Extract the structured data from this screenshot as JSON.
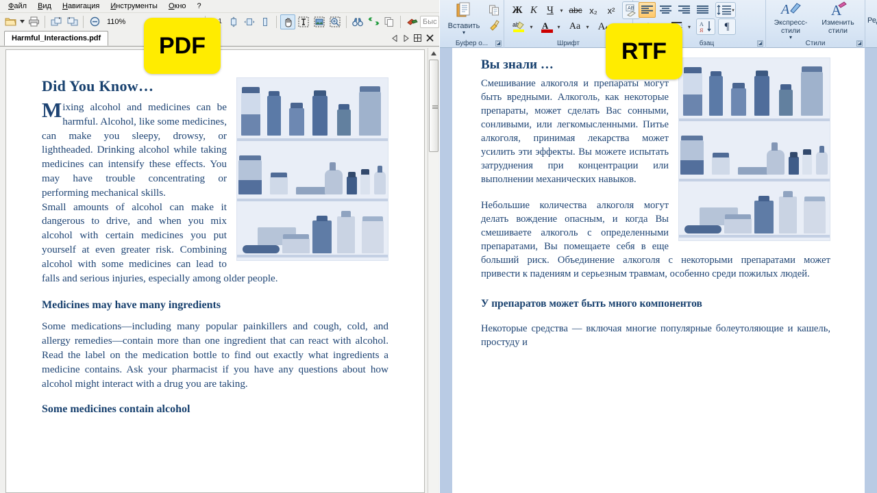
{
  "badges": {
    "pdf": "PDF",
    "rtf": "RTF"
  },
  "pdf_viewer": {
    "menu": [
      {
        "label": "Файл",
        "accel": "Ф"
      },
      {
        "label": "Вид",
        "accel": "В"
      },
      {
        "label": "Навигация",
        "accel": "Н"
      },
      {
        "label": "Инструменты",
        "accel": "И"
      },
      {
        "label": "Окно",
        "accel": "О"
      },
      {
        "label": "?",
        "accel": ""
      }
    ],
    "toolbar": {
      "open_icon": "folder-open-icon",
      "open_dropdown_icon": "chevron-down-icon",
      "print_icon": "printer-icon",
      "prev_view_icon": "previous-view-icon",
      "next_view_icon": "next-view-icon",
      "zoom_out_icon": "zoom-out-icon",
      "zoom_level": "110%",
      "zoom_in_icon": "zoom-in-icon",
      "actual_size_label": "1:1",
      "fit_page_icon": "fit-page-icon",
      "fit_width_icon": "fit-width-icon",
      "fit_height_icon": "fit-height-icon",
      "hand_tool_icon": "hand-tool-icon",
      "text_select_icon": "text-select-icon",
      "image_select_icon": "image-select-icon",
      "zoom_select_icon": "zoom-select-icon",
      "find_icon": "binoculars-find-icon",
      "convert_icon": "convert-arrows-icon",
      "copy_icon": "copy-icon",
      "highlight_icon": "highlight-icon",
      "search_placeholder": "Быс"
    },
    "tab": {
      "title": "Harmful_Interactions.pdf"
    },
    "nav": {
      "prev_page_icon": "previous-page-icon",
      "next_page_icon": "next-page-icon",
      "tile_icon": "tile-pages-icon",
      "close_icon": "close-icon"
    },
    "scrollbar": {
      "up_arrow_icon": "scroll-up-icon",
      "thumb_icon": "scroll-thumb-grip"
    },
    "document": {
      "heading1": "Did You Know…",
      "dropcap": "M",
      "para1_rest": "ixing alcohol and medicines can be harmful. Alcohol, like some medicines, can make you sleepy, drowsy, or lightheaded. Drinking alcohol while taking medicines can intensify these effects. You may have trouble concentrating or performing mechanical skills.",
      "para2": "Small amounts of alcohol can make it dangerous to drive, and when you mix alcohol with certain medicines you put yourself at even greater risk. Combining alcohol with some medicines can lead to falls and serious injuries, especially among older people.",
      "heading2": "Medicines may have many ingredients",
      "para3": "Some medications—including many popular painkillers and cough, cold, and allergy remedies—contain more than one ingredient that can react with alcohol. Read the label on the medication bottle to find out exactly what ingredients a medicine contains. Ask your pharmacist if you have any questions about how alcohol might interact with a drug you are taking.",
      "image_alt": "medicine-bottles-on-shelves-photo"
    }
  },
  "word": {
    "ribbon": {
      "groups": [
        {
          "name": "clipboard",
          "label": "Буфер о..."
        },
        {
          "name": "font",
          "label": "Шрифт"
        },
        {
          "name": "paragraph",
          "label": "бзац"
        },
        {
          "name": "styles",
          "label": "Стили"
        },
        {
          "name": "editing",
          "label": "Редакт"
        }
      ],
      "clipboard": {
        "paste_label": "Вставить",
        "paste_icon": "paste-icon",
        "paste_dropdown_icon": "chevron-down-icon",
        "copy_icon": "copy-icon",
        "format_painter_icon": "format-painter-icon"
      },
      "font": {
        "bold": "Ж",
        "italic": "К",
        "underline": "Ч",
        "underline_dropdown_icon": "chevron-down-icon",
        "strikethrough": "abc",
        "subscript": "x₂",
        "superscript": "x²",
        "clear_format_icon": "clear-formatting-icon",
        "highlight_icon": "text-highlight-icon",
        "highlight_dropdown_icon": "chevron-down-icon",
        "font_color": "A",
        "font_color_dropdown_icon": "chevron-down-icon",
        "change_case": "Aa",
        "change_case_dropdown_icon": "chevron-down-icon",
        "grow_font": "A",
        "shrink_font": "A"
      },
      "paragraph": {
        "align_left_icon": "align-left-icon",
        "align_center_icon": "align-center-icon",
        "align_right_icon": "align-right-icon",
        "align_justify_icon": "align-justify-icon",
        "line_spacing_icon": "line-spacing-icon",
        "line_spacing_dropdown_icon": "chevron-down-icon",
        "shading_icon": "shading-icon",
        "borders_icon": "borders-icon",
        "borders_dropdown_icon": "chevron-down-icon",
        "sort_icon": "sort-az-icon",
        "show_marks_icon": "pilcrow-icon"
      },
      "styles": {
        "quick_styles_label": "Экспресс-стили",
        "quick_styles_icon": "quick-styles-icon",
        "quick_styles_dropdown_icon": "chevron-down-icon",
        "change_styles_label": "Изменить стили",
        "change_styles_icon": "change-styles-icon",
        "change_styles_dropdown_icon": "chevron-down-icon"
      },
      "editing": {
        "label": "Редакт"
      }
    },
    "document": {
      "heading1": "Вы знали …",
      "para1": "Смешивание алкоголя и препараты могут быть вредными. Алкоголь, как некоторые препараты, может сделать Вас сонными, сонливыми, или легкомысленными. Питье алкоголя, принимая лекарства может усилить эти эффекты. Вы можете испытать затруднения при концентрации или выполнении механических навыков.",
      "para2": "Небольшие количества алкоголя могут делать вождение опасным, и когда Вы смешиваете алкоголь с определенными препаратами, Вы помещаете себя в еще больший риск. Объединение алкоголя с некоторыми препаратами может привести к падениям и серьезным травмам, особенно среди пожилых людей.",
      "heading2": "У препаратов может быть много компонентов",
      "para3": "Некоторые средства — включая многие популярные болеутоляющие и кашель, простуду и",
      "image_alt": "medicine-bottles-on-shelves-photo"
    }
  },
  "colors": {
    "pdf_text": "#1d4373",
    "pdf_heading": "#17406e",
    "badge_yellow": "#ffec00",
    "ribbon_blue": "#dce8f6",
    "word_canvas": "#b9cbe4"
  }
}
